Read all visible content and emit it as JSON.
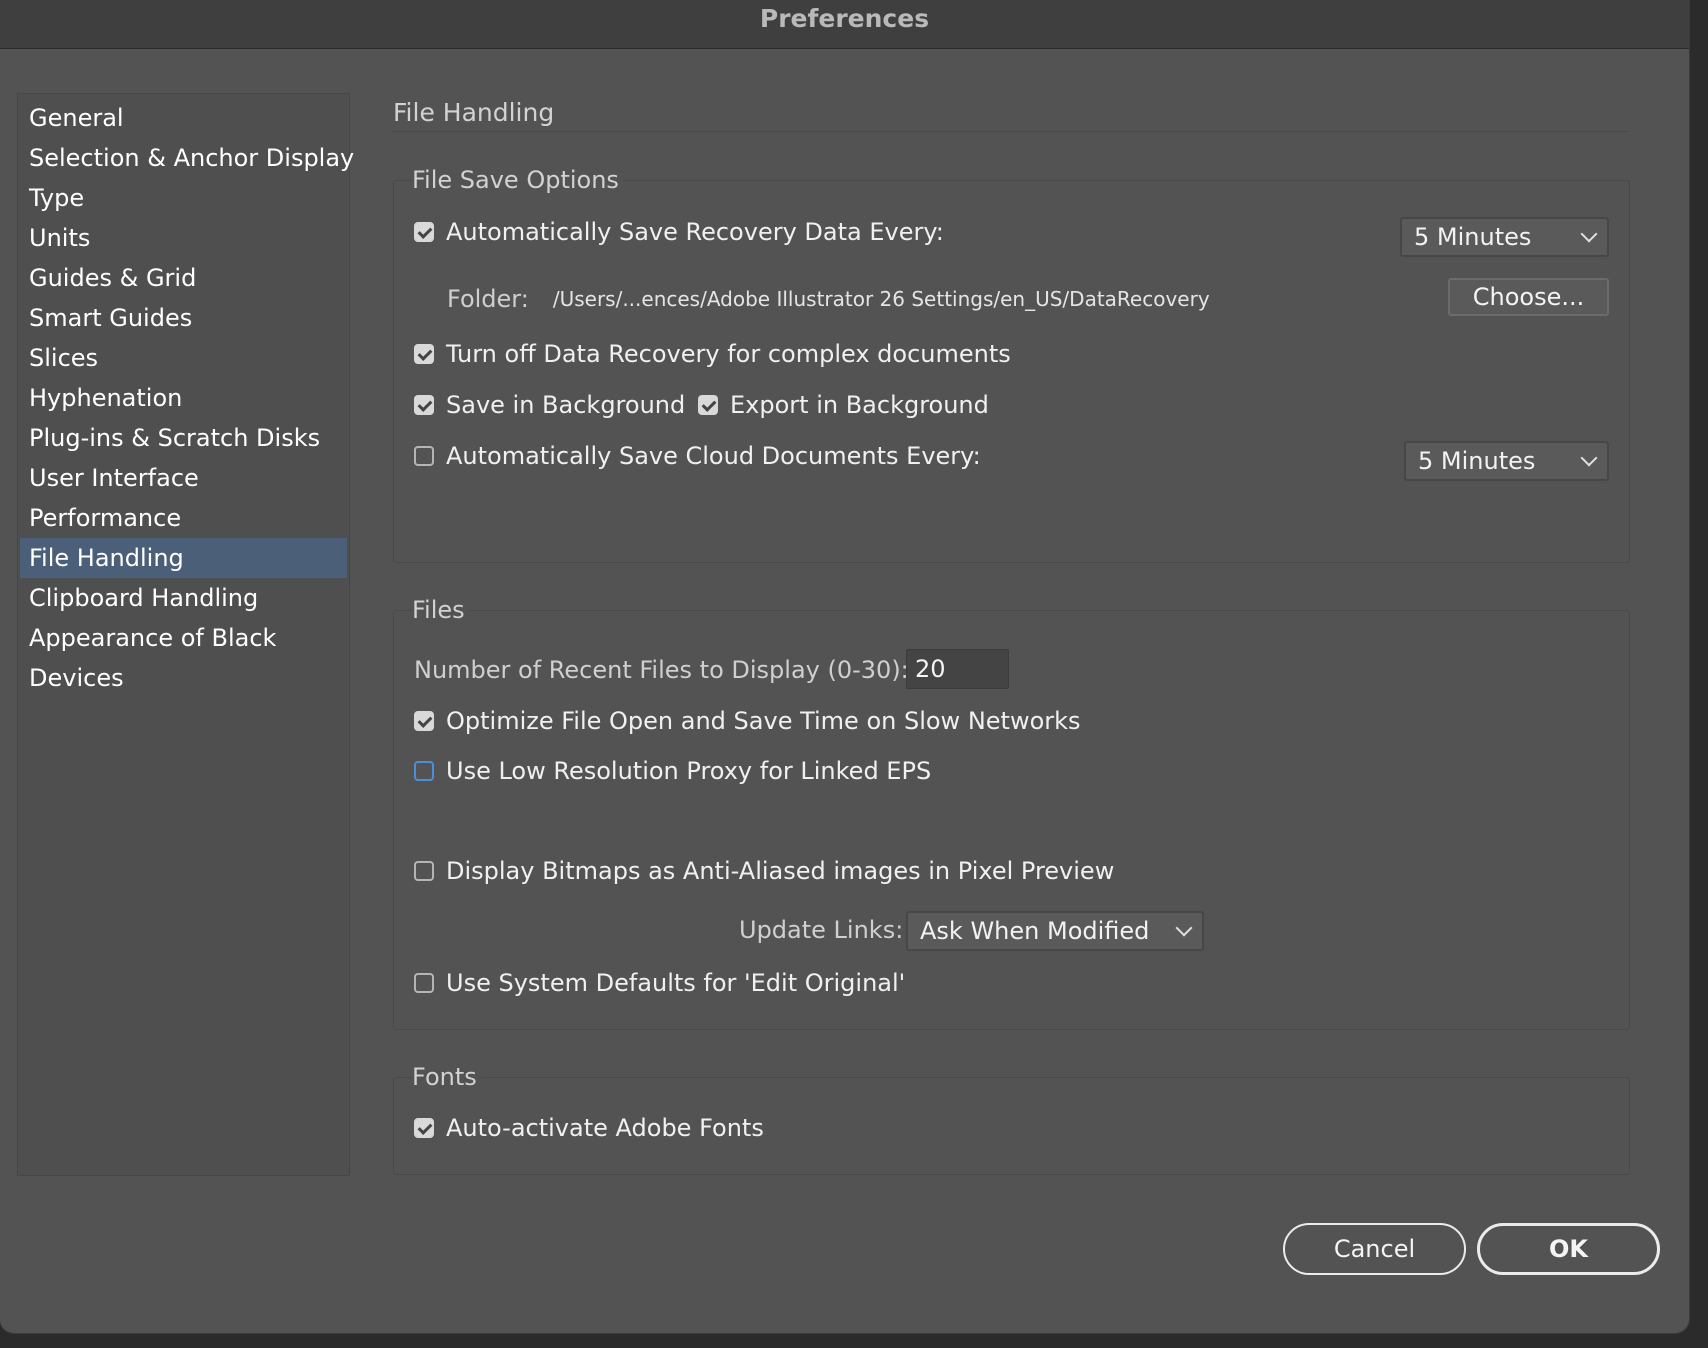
{
  "window": {
    "title": "Preferences"
  },
  "sidebar": {
    "items": [
      {
        "label": "General"
      },
      {
        "label": "Selection & Anchor Display"
      },
      {
        "label": "Type"
      },
      {
        "label": "Units"
      },
      {
        "label": "Guides & Grid"
      },
      {
        "label": "Smart Guides"
      },
      {
        "label": "Slices"
      },
      {
        "label": "Hyphenation"
      },
      {
        "label": "Plug-ins & Scratch Disks"
      },
      {
        "label": "User Interface"
      },
      {
        "label": "Performance"
      },
      {
        "label": "File Handling",
        "selected": true
      },
      {
        "label": "Clipboard Handling"
      },
      {
        "label": "Appearance of Black"
      },
      {
        "label": "Devices"
      }
    ]
  },
  "page": {
    "title": "File Handling"
  },
  "file_save_options": {
    "label": "File Save Options",
    "auto_save_recovery": {
      "label": "Automatically Save Recovery Data Every:",
      "checked": true,
      "interval": "5 Minutes"
    },
    "folder": {
      "label": "Folder:",
      "path": "/Users/...ences/Adobe Illustrator 26 Settings/en_US/DataRecovery",
      "choose_label": "Choose..."
    },
    "turn_off_recovery": {
      "label": "Turn off Data Recovery for complex documents",
      "checked": true
    },
    "save_background": {
      "label": "Save in Background",
      "checked": true
    },
    "export_background": {
      "label": "Export in Background",
      "checked": true
    },
    "auto_save_cloud": {
      "label": "Automatically Save Cloud Documents Every:",
      "checked": false,
      "interval": "5 Minutes"
    }
  },
  "files": {
    "label": "Files",
    "recent_files": {
      "label": "Number of Recent Files to Display (0-30):",
      "value": "20"
    },
    "optimize_open_save": {
      "label": "Optimize File Open and Save Time on Slow Networks",
      "checked": true
    },
    "low_res_proxy": {
      "label": "Use Low Resolution Proxy for Linked EPS",
      "checked": false
    },
    "anti_aliased": {
      "label": "Display Bitmaps as Anti-Aliased images in Pixel Preview",
      "checked": false
    },
    "update_links": {
      "label": "Update Links:",
      "value": "Ask When Modified"
    },
    "system_defaults": {
      "label": "Use System Defaults for 'Edit Original'",
      "checked": false
    }
  },
  "fonts": {
    "label": "Fonts",
    "auto_activate": {
      "label": "Auto-activate Adobe Fonts",
      "checked": true
    }
  },
  "footer": {
    "cancel_label": "Cancel",
    "ok_label": "OK"
  }
}
